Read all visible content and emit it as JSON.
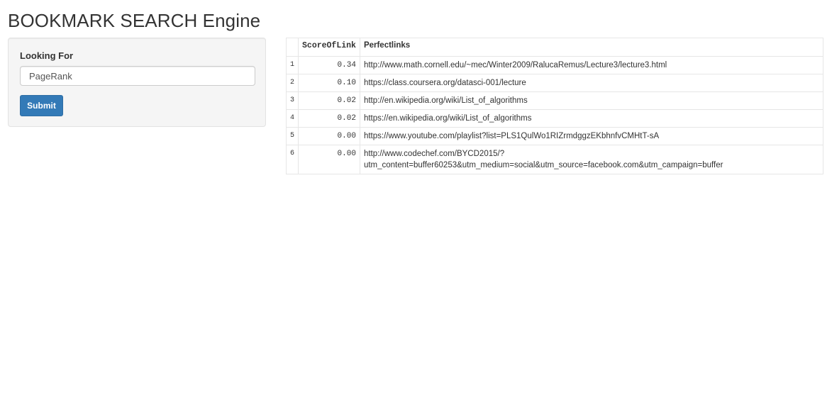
{
  "page": {
    "title": "BOOKMARK SEARCH Engine"
  },
  "form": {
    "label": "Looking For",
    "input_value": "PageRank",
    "submit_label": "Submit"
  },
  "table": {
    "headers": {
      "index": "",
      "score": "ScoreOfLink",
      "link": "Perfectlinks"
    },
    "rows": [
      {
        "index": "1",
        "score": "0.34",
        "link": "http://www.math.cornell.edu/~mec/Winter2009/RalucaRemus/Lecture3/lecture3.html"
      },
      {
        "index": "2",
        "score": "0.10",
        "link": "https://class.coursera.org/datasci-001/lecture"
      },
      {
        "index": "3",
        "score": "0.02",
        "link": "http://en.wikipedia.org/wiki/List_of_algorithms"
      },
      {
        "index": "4",
        "score": "0.02",
        "link": "https://en.wikipedia.org/wiki/List_of_algorithms"
      },
      {
        "index": "5",
        "score": "0.00",
        "link": "https://www.youtube.com/playlist?list=PLS1QulWo1RIZrmdggzEKbhnfvCMHtT-sA"
      },
      {
        "index": "6",
        "score": "0.00",
        "link_line1": "http://www.codechef.com/BYCD2015/?",
        "link_line2": "utm_content=buffer60253&utm_medium=social&utm_source=facebook.com&utm_campaign=buffer"
      }
    ]
  },
  "colors": {
    "primary_button": "#337ab7",
    "panel_background": "#f5f5f5"
  }
}
